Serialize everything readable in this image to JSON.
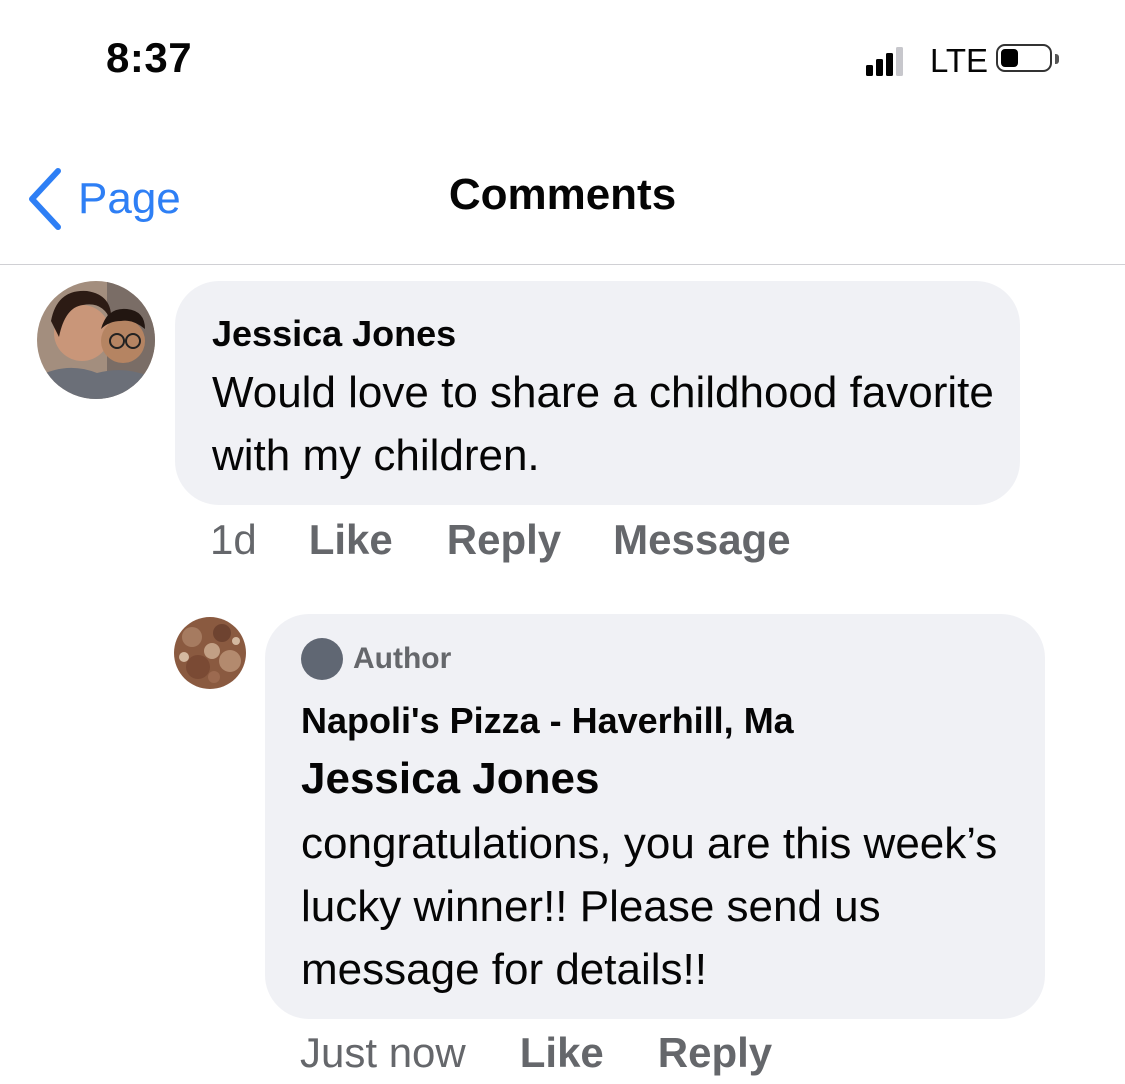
{
  "status_bar": {
    "time": "8:37",
    "network": "LTE",
    "signal_bars": 3,
    "battery_level": 0.3
  },
  "nav": {
    "back_label": "Page",
    "title": "Comments",
    "accent": "#2e7ff5"
  },
  "comments": [
    {
      "author": "Jessica Jones",
      "text": "Would love to share a childhood favorite with my children.",
      "time": "1d",
      "actions": {
        "like": "Like",
        "reply": "Reply",
        "message": "Message"
      }
    }
  ],
  "reply": {
    "badge": "Author",
    "author": "Napoli's Pizza - Haverhill, Ma",
    "mention": "Jessica Jones",
    "text": "congratulations, you are this week’s lucky winner!! Please send us message for details!!",
    "time": "Just now",
    "actions": {
      "like": "Like",
      "reply": "Reply"
    }
  }
}
